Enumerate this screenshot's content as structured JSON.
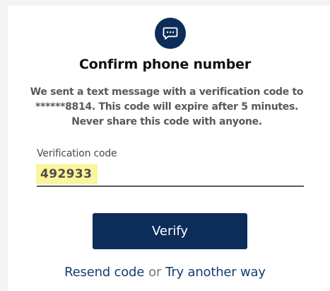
{
  "header": {
    "icon": "chat-bubble-icon",
    "title": "Confirm phone number",
    "message_line1": "We sent a text message with a verification code to",
    "message_line2": "******8814. This code will expire after 5 minutes.",
    "message_line3": "Never share this code with anyone."
  },
  "form": {
    "code_label": "Verification code",
    "code_value": "492933",
    "verify_label": "Verify"
  },
  "footer": {
    "resend_label": "Resend code",
    "or_label": "or",
    "try_another_label": "Try another way"
  },
  "colors": {
    "primary": "#0c2c5a",
    "highlight": "#fbf59b",
    "link": "#163c72"
  }
}
